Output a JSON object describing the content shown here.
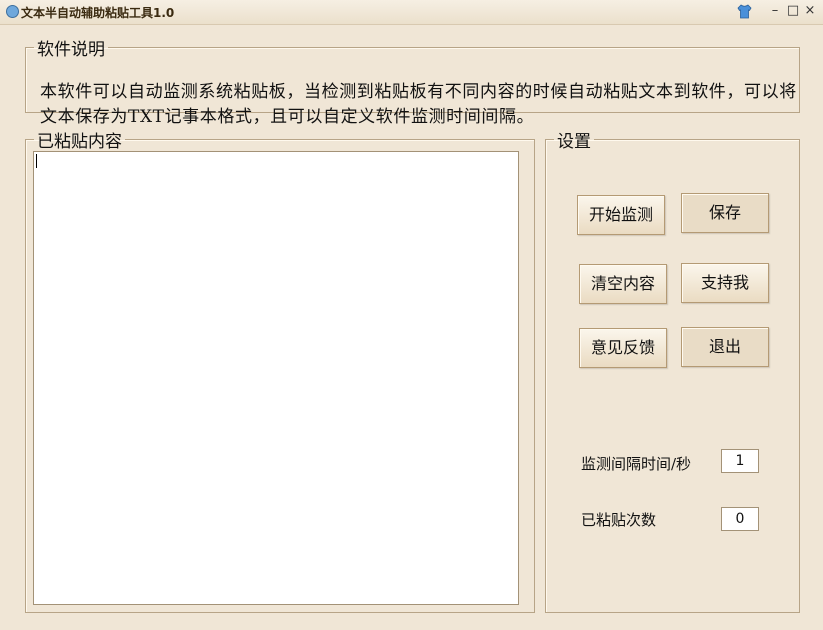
{
  "window": {
    "title": "文本半自动辅助粘贴工具1.0",
    "icon": "app-icon",
    "controls": {
      "minimize": "–",
      "maximize": "□",
      "close": "×"
    }
  },
  "description": {
    "legend": "软件说明",
    "text": "本软件可以自动监测系统粘贴板，当检测到粘贴板有不同内容的时候自动粘贴文本到软件，可以将文本保存为TXT记事本格式，且可以自定义软件监测时间间隔。"
  },
  "pasted": {
    "legend": "已粘贴内容",
    "content": ""
  },
  "settings": {
    "legend": "设置",
    "buttons": {
      "start": "开始监测",
      "save": "保存",
      "clear": "清空内容",
      "support": "支持我",
      "feedback": "意见反馈",
      "exit": "退出"
    },
    "interval_label": "监测间隔时间/秒",
    "interval_value": "1",
    "count_label": "已粘贴次数",
    "count_value": "0"
  },
  "colors": {
    "background": "#f0e6d6",
    "border": "#b7a487",
    "button": "#eadbc2"
  }
}
